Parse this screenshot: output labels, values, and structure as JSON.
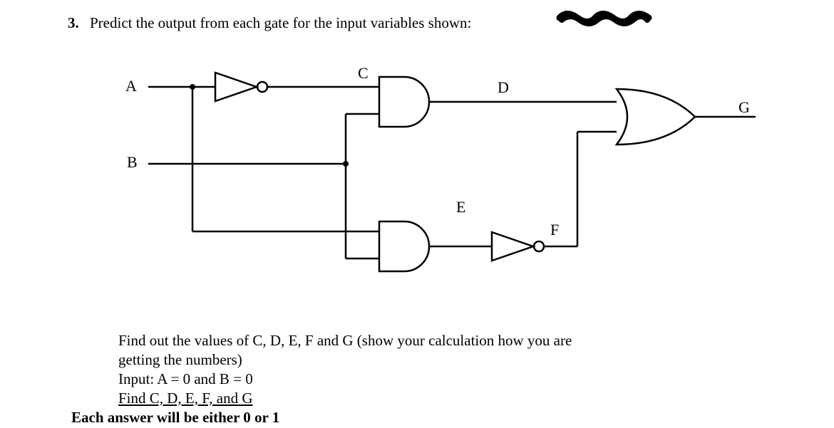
{
  "question": {
    "number": "3.",
    "prompt": "Predict the output from each gate for the input variables shown:"
  },
  "circuit": {
    "inputs": {
      "A": "A",
      "B": "B"
    },
    "nodes": {
      "C": "C",
      "D": "D",
      "E": "E",
      "F": "F",
      "G": "G"
    },
    "gates": {
      "not1": {
        "type": "NOT",
        "inputs": [
          "A"
        ],
        "output": "C"
      },
      "and1": {
        "type": "AND",
        "inputs": [
          "C",
          "B"
        ],
        "output": "D"
      },
      "and2": {
        "type": "AND",
        "inputs": [
          "A",
          "B"
        ],
        "output": "E"
      },
      "not2": {
        "type": "NOT",
        "inputs": [
          "E"
        ],
        "output": "F"
      },
      "or1": {
        "type": "OR",
        "inputs": [
          "D",
          "F"
        ],
        "output": "G"
      }
    }
  },
  "task": {
    "line1": "Find out the values of C, D, E, F and G (show your calculation how you are",
    "line2": "getting the numbers)",
    "line3": "Input: A = 0 and B = 0",
    "line4": "Find C, D, E, F, and G",
    "line5": "Each answer will be either 0 or 1"
  }
}
